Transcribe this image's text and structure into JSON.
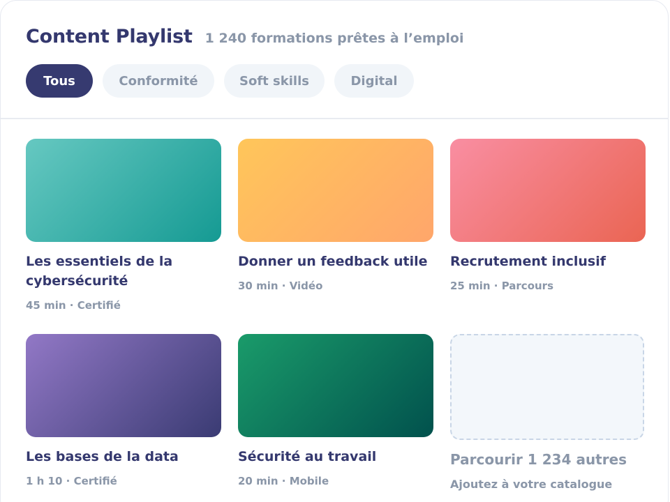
{
  "header": {
    "title": "Content Playlist",
    "subtitle": "1 240 formations prêtes à l’emploi"
  },
  "filters": [
    {
      "label": "Tous",
      "active": true
    },
    {
      "label": "Conformité",
      "active": false
    },
    {
      "label": "Soft skills",
      "active": false
    },
    {
      "label": "Digital",
      "active": false
    }
  ],
  "cards": [
    {
      "title_line1": "Les essentiels de la",
      "title_line2": "cybersécurité",
      "meta": "45 min · Certifié",
      "color_start": "#66c8c1",
      "color_end": "#159a93"
    },
    {
      "title_line1": "Donner un feedback utile",
      "meta": "30 min · Vidéo",
      "color_start": "#ffc65a",
      "color_end": "#ffa66b"
    },
    {
      "title_line1": "Recrutement inclusif",
      "meta": "25 min · Parcours",
      "color_start": "#f98ea2",
      "color_end": "#ea6553"
    },
    {
      "title_line1": "Les bases de la data",
      "meta": "1 h 10 · Certifié",
      "color_start": "#9278c6",
      "color_end": "#3a3b73"
    },
    {
      "title_line1": "Sécurité au travail",
      "meta": "20 min · Mobile",
      "color_start": "#1a9b6a",
      "color_end": "#01514d"
    }
  ],
  "browse_card": {
    "title": "Parcourir 1 234 autres",
    "subtitle": "Ajoutez à votre catalogue"
  },
  "colors": {
    "accent": "#363a70",
    "muted_text": "#8a96a8",
    "chip_bg": "#f1f5f9"
  }
}
